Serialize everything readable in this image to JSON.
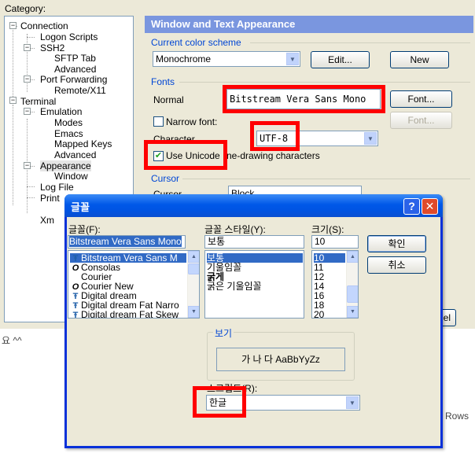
{
  "settings": {
    "category_label": "Category:",
    "tree": [
      {
        "label": "Connection",
        "level": 0
      },
      {
        "label": "Logon Scripts",
        "level": 1
      },
      {
        "label": "SSH2",
        "level": 1
      },
      {
        "label": "SFTP Tab",
        "level": 2
      },
      {
        "label": "Advanced",
        "level": 2
      },
      {
        "label": "Port Forwarding",
        "level": 1
      },
      {
        "label": "Remote/X11",
        "level": 2
      },
      {
        "label": "Terminal",
        "level": 0
      },
      {
        "label": "Emulation",
        "level": 1
      },
      {
        "label": "Modes",
        "level": 2
      },
      {
        "label": "Emacs",
        "level": 2
      },
      {
        "label": "Mapped Keys",
        "level": 2
      },
      {
        "label": "Advanced",
        "level": 2
      },
      {
        "label": "Appearance",
        "level": 1,
        "selected": true
      },
      {
        "label": "Window",
        "level": 2
      },
      {
        "label": "Log File",
        "level": 1
      },
      {
        "label": "Print",
        "level": 1
      },
      {
        "label": "Xm",
        "level": 1
      }
    ],
    "panel_title": "Window and Text Appearance",
    "color_scheme": {
      "group_label": "Current color scheme",
      "value": "Monochrome",
      "edit_label": "Edit...",
      "new_label": "New"
    },
    "fonts": {
      "group_label": "Fonts",
      "normal_label": "Normal",
      "normal_font": "Bitstream Vera Sans Mono",
      "font_button": "Font...",
      "narrow_label": "Narrow font:",
      "narrow_font_button": "Font...",
      "character_label": "Character",
      "character_value": "UTF-8",
      "unicode_label": "Use Unicode",
      "unicode_checked": true,
      "line_drawing_label": "ne-drawing characters"
    },
    "cursor": {
      "group_label": "Cursor",
      "style_label": "Cursor",
      "style_value": "Block"
    },
    "partial": {
      "cancel_fragment": "el",
      "rows_fragment": "8 Rows",
      "terminal_fragment": "요 ^^"
    }
  },
  "font_dialog": {
    "title": "글꼴",
    "help_icon": "?",
    "close_icon": "✕",
    "font_label": "글꼴(F):",
    "font_value": "Bitstream Vera Sans Mono",
    "fonts": [
      {
        "name": "Bitstream Vera Sans M",
        "icon": "tt",
        "selected": true
      },
      {
        "name": "Consolas",
        "icon": "o"
      },
      {
        "name": "Courier",
        "icon": ""
      },
      {
        "name": "Courier New",
        "icon": "o"
      },
      {
        "name": "Digital dream",
        "icon": "tt"
      },
      {
        "name": "Digital dream Fat Narro",
        "icon": "tt"
      },
      {
        "name": "Digital dream Fat Skew",
        "icon": "tt"
      }
    ],
    "style_label": "글꼴 스타일(Y):",
    "style_value": "보통",
    "styles": [
      {
        "name": "보통",
        "selected": true
      },
      {
        "name": "기울임꼴"
      },
      {
        "name": "굵게"
      },
      {
        "name": "굵은 기울임꼴"
      }
    ],
    "size_label": "크기(S):",
    "size_value": "10",
    "sizes": [
      {
        "name": "10",
        "selected": true
      },
      {
        "name": "11"
      },
      {
        "name": "12"
      },
      {
        "name": "14"
      },
      {
        "name": "16"
      },
      {
        "name": "18"
      },
      {
        "name": "20"
      }
    ],
    "ok_label": "확인",
    "cancel_label": "취소",
    "preview_label": "보기",
    "preview_text": "가 나 다 AaBbYyZz",
    "script_label": "스크립트(R):",
    "script_value": "한글"
  },
  "colors": {
    "highlight_red": "#ff0000",
    "panel_title_bg": "#7a96df",
    "dialog_title": "#0054e3",
    "selection": "#316ac5"
  }
}
